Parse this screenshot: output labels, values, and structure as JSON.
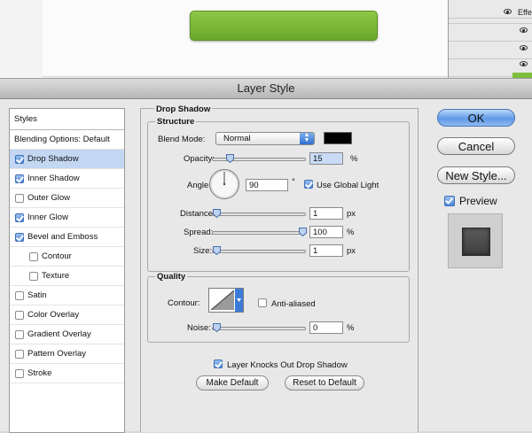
{
  "background": {
    "effects_label": "Effe",
    "accent_green": "#7fbe3b"
  },
  "dialog": {
    "title": "Layer Style"
  },
  "styles_list": {
    "header": "Styles",
    "items": [
      {
        "label": "Blending Options: Default",
        "has_checkbox": false,
        "checked": false,
        "selected": false
      },
      {
        "label": "Drop Shadow",
        "has_checkbox": true,
        "checked": true,
        "selected": true
      },
      {
        "label": "Inner Shadow",
        "has_checkbox": true,
        "checked": true,
        "selected": false
      },
      {
        "label": "Outer Glow",
        "has_checkbox": true,
        "checked": false,
        "selected": false
      },
      {
        "label": "Inner Glow",
        "has_checkbox": true,
        "checked": true,
        "selected": false
      },
      {
        "label": "Bevel and Emboss",
        "has_checkbox": true,
        "checked": true,
        "selected": false
      },
      {
        "label": "Contour",
        "has_checkbox": true,
        "checked": false,
        "selected": false
      },
      {
        "label": "Texture",
        "has_checkbox": true,
        "checked": false,
        "selected": false
      },
      {
        "label": "Satin",
        "has_checkbox": true,
        "checked": false,
        "selected": false
      },
      {
        "label": "Color Overlay",
        "has_checkbox": true,
        "checked": false,
        "selected": false
      },
      {
        "label": "Gradient Overlay",
        "has_checkbox": true,
        "checked": false,
        "selected": false
      },
      {
        "label": "Pattern Overlay",
        "has_checkbox": true,
        "checked": false,
        "selected": false
      },
      {
        "label": "Stroke",
        "has_checkbox": true,
        "checked": false,
        "selected": false
      }
    ]
  },
  "drop_shadow": {
    "section_title": "Drop Shadow",
    "structure": {
      "title": "Structure",
      "blend_mode_label": "Blend Mode:",
      "blend_mode_value": "Normal",
      "shadow_color": "#000000",
      "opacity_label": "Opacity:",
      "opacity_value": "15",
      "opacity_fraction": 0.15,
      "opacity_unit": "%",
      "angle_label": "Angle:",
      "angle_value": "90",
      "angle_degrees": 90,
      "angle_unit": "°",
      "use_global_light_label": "Use Global Light",
      "use_global_light_checked": true,
      "distance_label": "Distance:",
      "distance_value": "1",
      "distance_fraction": 0.0,
      "distance_unit": "px",
      "spread_label": "Spread:",
      "spread_value": "100",
      "spread_fraction": 1.0,
      "spread_unit": "%",
      "size_label": "Size:",
      "size_value": "1",
      "size_fraction": 0.0,
      "size_unit": "px"
    },
    "quality": {
      "title": "Quality",
      "contour_label": "Contour:",
      "anti_aliased_label": "Anti-aliased",
      "anti_aliased_checked": false,
      "noise_label": "Noise:",
      "noise_value": "0",
      "noise_fraction": 0.0,
      "noise_unit": "%"
    },
    "knockout_label": "Layer Knocks Out Drop Shadow",
    "knockout_checked": true,
    "make_default_label": "Make Default",
    "reset_default_label": "Reset to Default"
  },
  "buttons": {
    "ok": "OK",
    "cancel": "Cancel",
    "new_style": "New Style...",
    "preview_label": "Preview",
    "preview_checked": true
  }
}
